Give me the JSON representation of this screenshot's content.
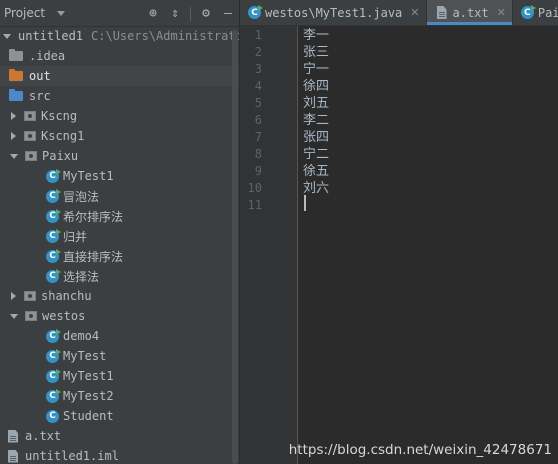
{
  "project_panel": {
    "title": "Project",
    "header_icons": [
      "crosshair-icon",
      "collapse-icon",
      "gear-icon",
      "minimize-icon"
    ],
    "tree": [
      {
        "label": "untitled1",
        "path": "C:\\Users\\Administrator\\",
        "icon": "project-folder-icon",
        "expanded": true
      },
      {
        "label": ".idea",
        "icon": "folder-icon"
      },
      {
        "label": "out",
        "icon": "excluded-folder-icon",
        "selected": true
      },
      {
        "label": "src",
        "icon": "source-folder-icon"
      },
      {
        "label": "Kscng",
        "icon": "package-icon",
        "expanded": false
      },
      {
        "label": "Kscng1",
        "icon": "package-icon",
        "expanded": false
      },
      {
        "label": "Paixu",
        "icon": "package-icon",
        "expanded": true
      },
      {
        "label": "MyTest1",
        "icon": "runnable-class-icon"
      },
      {
        "label": "冒泡法",
        "icon": "runnable-class-icon"
      },
      {
        "label": "希尔排序法",
        "icon": "runnable-class-icon"
      },
      {
        "label": "归并",
        "icon": "runnable-class-icon"
      },
      {
        "label": "直接排序法",
        "icon": "runnable-class-icon"
      },
      {
        "label": "选择法",
        "icon": "runnable-class-icon"
      },
      {
        "label": "shanchu",
        "icon": "package-icon",
        "expanded": false
      },
      {
        "label": "westos",
        "icon": "package-icon",
        "expanded": true
      },
      {
        "label": "demo4",
        "icon": "runnable-class-icon"
      },
      {
        "label": "MyTest",
        "icon": "runnable-class-icon"
      },
      {
        "label": "MyTest1",
        "icon": "runnable-class-icon"
      },
      {
        "label": "MyTest2",
        "icon": "runnable-class-icon"
      },
      {
        "label": "Student",
        "icon": "class-icon"
      },
      {
        "label": "a.txt",
        "icon": "text-file-icon"
      },
      {
        "label": "untitled1.iml",
        "icon": "module-file-icon"
      }
    ]
  },
  "editor": {
    "tabs": [
      {
        "label": "westos\\MyTest1.java",
        "icon": "runnable-class-icon",
        "active": false
      },
      {
        "label": "a.txt",
        "icon": "text-file-icon",
        "active": true
      },
      {
        "label": "Paix",
        "icon": "runnable-class-icon",
        "active": false
      }
    ],
    "line_numbers": [
      "1",
      "2",
      "3",
      "4",
      "5",
      "6",
      "7",
      "8",
      "9",
      "10",
      "11"
    ],
    "lines": [
      "李一",
      "张三",
      "宁一",
      "徐四",
      "刘五",
      "李二",
      "张四",
      "宁二",
      "徐五",
      "刘六",
      ""
    ]
  },
  "watermark": "https://blog.csdn.net/weixin_42478671",
  "colors": {
    "panel_bg": "#3c3f41",
    "editor_bg": "#2b2b2b",
    "accent": "#4a88c7",
    "class_icon": "#3592c4"
  }
}
